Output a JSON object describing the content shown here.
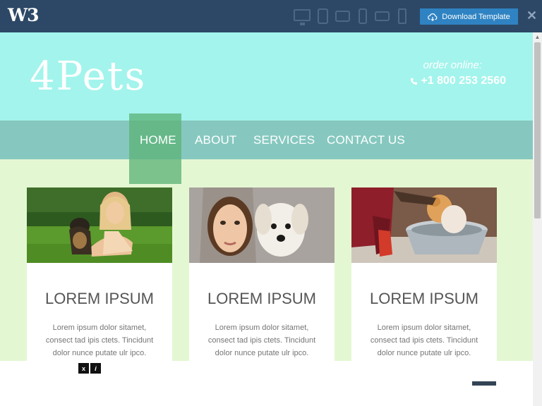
{
  "topbar": {
    "logo": "W3",
    "download_label": "Download Template",
    "close_glyph": "✕"
  },
  "header": {
    "brand": "4Pets",
    "order_label": "order online:",
    "phone": "+1 800 253 2560"
  },
  "nav": [
    {
      "label": "HOME",
      "active": true
    },
    {
      "label": "ABOUT",
      "active": false
    },
    {
      "label": "SERVICES",
      "active": false
    },
    {
      "label": "CONTACT US",
      "active": false
    }
  ],
  "cards": [
    {
      "title": "LOREM IPSUM",
      "text": "Lorem ipsum dolor sitamet, consect tad ipis ctets. Tincidunt dolor nunce putate ulr ipco."
    },
    {
      "title": "LOREM IPSUM",
      "text": "Lorem ipsum dolor sitamet, consect tad ipis ctets. Tincidunt dolor nunce putate ulr ipco."
    },
    {
      "title": "LOREM IPSUM",
      "text": "Lorem ipsum dolor sitamet, consect tad ipis ctets. Tincidunt dolor nunce putate ulr ipco."
    }
  ],
  "mini_buttons": [
    "x",
    "i"
  ],
  "colors": {
    "topbar": "#2d4866",
    "download_button": "#2f83c2",
    "header_band": "#a3f4ec",
    "nav_band": "#86c8bf",
    "nav_active": "#5eb47a",
    "page_bg": "#e4f7d3"
  }
}
